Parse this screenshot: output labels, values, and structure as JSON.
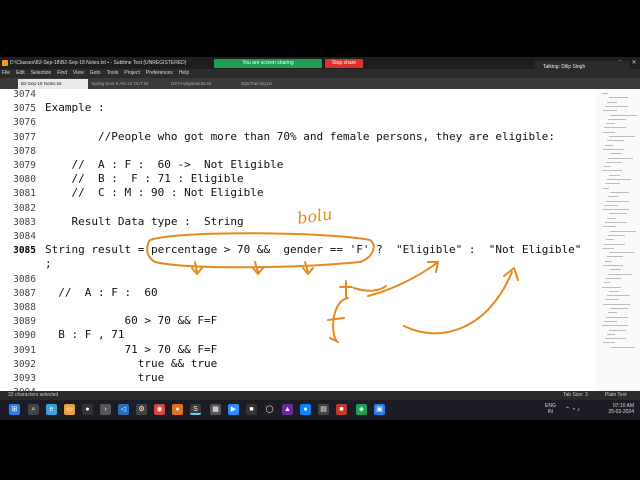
{
  "window": {
    "title": "D:\\Classes\\B2-Sep-18\\B2-Sep-18 Notes.txt • - Sublime Text (UNREGISTERED)",
    "share_banner": "You are screen sharing",
    "stop_share": "Stop share",
    "controls": [
      "–",
      "□",
      "✕"
    ]
  },
  "menu": [
    "File",
    "Edit",
    "Selection",
    "Find",
    "View",
    "Goto",
    "Tools",
    "Project",
    "Preferences",
    "Help"
  ],
  "tabs": [
    {
      "label": "B2-Sep-18 Notes.txt",
      "active": true
    },
    {
      "label": "Spring Boot 9 AM 24 OCT.txt",
      "active": false
    },
    {
      "label": "DSTAssignments.txt",
      "active": false
    },
    {
      "label": "SQLTraining.txt",
      "active": false
    }
  ],
  "talking": "Talking: Dilip Singh",
  "editor": {
    "lines": [
      {
        "num": "3074",
        "text": ""
      },
      {
        "num": "3075",
        "text": "Example :"
      },
      {
        "num": "3076",
        "text": ""
      },
      {
        "num": "3077",
        "text": "        //People who got more than 70% and female persons, they are eligible:"
      },
      {
        "num": "3078",
        "text": ""
      },
      {
        "num": "3079",
        "text": "    //  A : F :  60 ->  Not Eligible"
      },
      {
        "num": "3080",
        "text": "    //  B :  F : 71 : Eligible"
      },
      {
        "num": "3081",
        "text": "    //  C : M : 90 : Not Eligible"
      },
      {
        "num": "3082",
        "text": ""
      },
      {
        "num": "3083",
        "text": "    Result Data type :  String"
      },
      {
        "num": "3084",
        "text": ""
      },
      {
        "num": "3085",
        "text": "String result = percentage > 70 &&  gender == 'F' ?  \"Eligible\" :  \"Not Eligible\""
      },
      {
        "num": "",
        "text": ";"
      },
      {
        "num": "3086",
        "text": ""
      },
      {
        "num": "3087",
        "text": "  //  A : F :  60"
      },
      {
        "num": "3088",
        "text": ""
      },
      {
        "num": "3089",
        "text": "            60 > 70 && F=F"
      },
      {
        "num": "3090",
        "text": "  B : F , 71"
      },
      {
        "num": "3091",
        "text": "            71 > 70 && F=F"
      },
      {
        "num": "3092",
        "text": "              true && true"
      },
      {
        "num": "3093",
        "text": "              true"
      },
      {
        "num": "3094",
        "text": ""
      }
    ],
    "current_line": "3085"
  },
  "annotations": {
    "handwritten_word": "bolu",
    "symbols": [
      "+",
      "f"
    ]
  },
  "status": {
    "selection": "32 characters selected",
    "tab_size": "Tab Size: 3",
    "syntax": "Plain Text"
  },
  "taskbar": {
    "lang_top": "ENG",
    "lang_bottom": "IN",
    "time": "07:10 AM",
    "date": "25-03-2024"
  }
}
